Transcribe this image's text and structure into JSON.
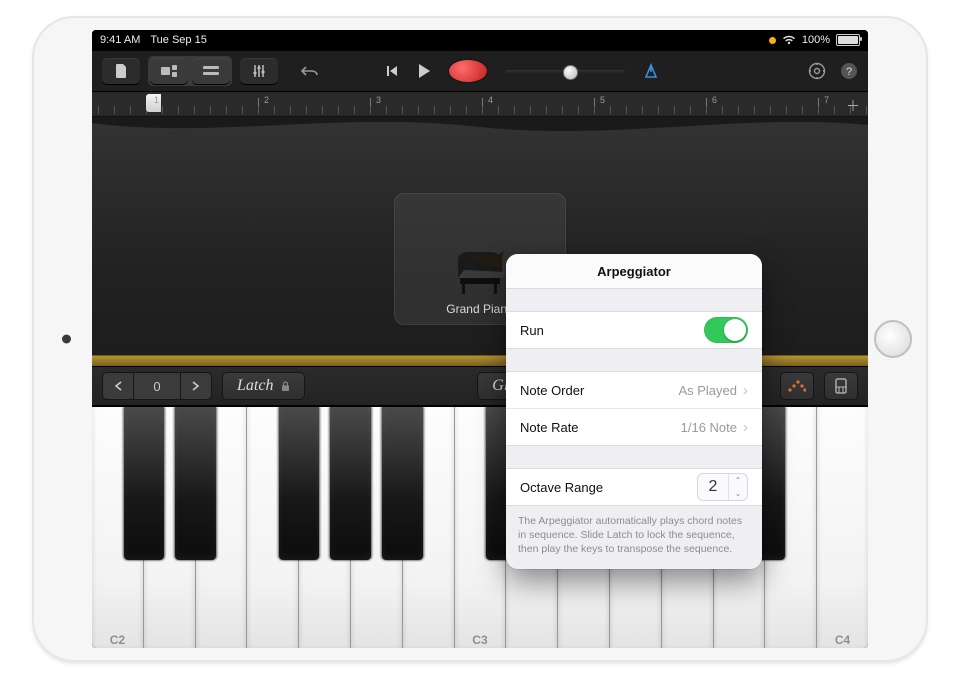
{
  "status": {
    "time": "9:41 AM",
    "date": "Tue Sep 15",
    "battery": "100%"
  },
  "ruler": {
    "marks": [
      "1",
      "2",
      "3",
      "4",
      "5",
      "6",
      "7"
    ]
  },
  "instrument": {
    "name": "Grand Piano"
  },
  "controls": {
    "octave_value": "0",
    "latch_label": "Latch",
    "mode_label": "Glissando"
  },
  "keyboard": {
    "labels": [
      "C2",
      "C3",
      "C4"
    ]
  },
  "popover": {
    "title": "Arpeggiator",
    "run_label": "Run",
    "run_on": true,
    "note_order_label": "Note Order",
    "note_order_value": "As Played",
    "note_rate_label": "Note Rate",
    "note_rate_value": "1/16 Note",
    "octave_range_label": "Octave Range",
    "octave_range_value": "2",
    "description": "The Arpeggiator automatically plays chord notes in sequence. Slide Latch to lock the sequence, then play the keys to transpose the sequence."
  }
}
